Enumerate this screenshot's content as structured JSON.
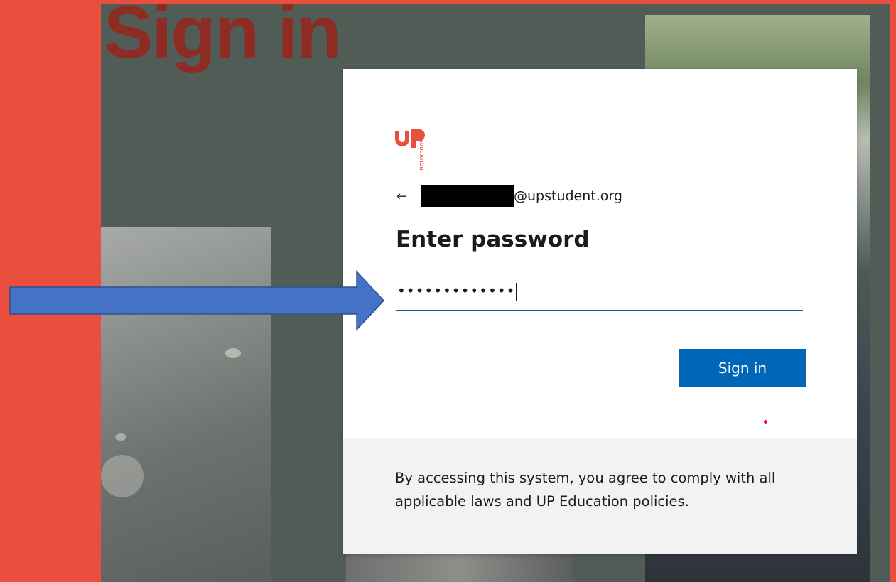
{
  "background": {
    "title": "Sign in"
  },
  "brand": {
    "logo_text": "UP",
    "logo_subtext": "EDUCATION",
    "accent": "#e94f3c"
  },
  "identity": {
    "email_suffix": "@upstudent.org",
    "back_icon": "arrow-left-icon"
  },
  "heading": "Enter password",
  "password": {
    "masked_value": "•••••••••••••"
  },
  "sign_in_button": {
    "label": "Sign in",
    "color": "#0067b8"
  },
  "footer": {
    "text": "By accessing this system, you agree to comply with all applicable laws and UP Education policies."
  },
  "annotation": {
    "arrow_color": "#4472c4"
  }
}
